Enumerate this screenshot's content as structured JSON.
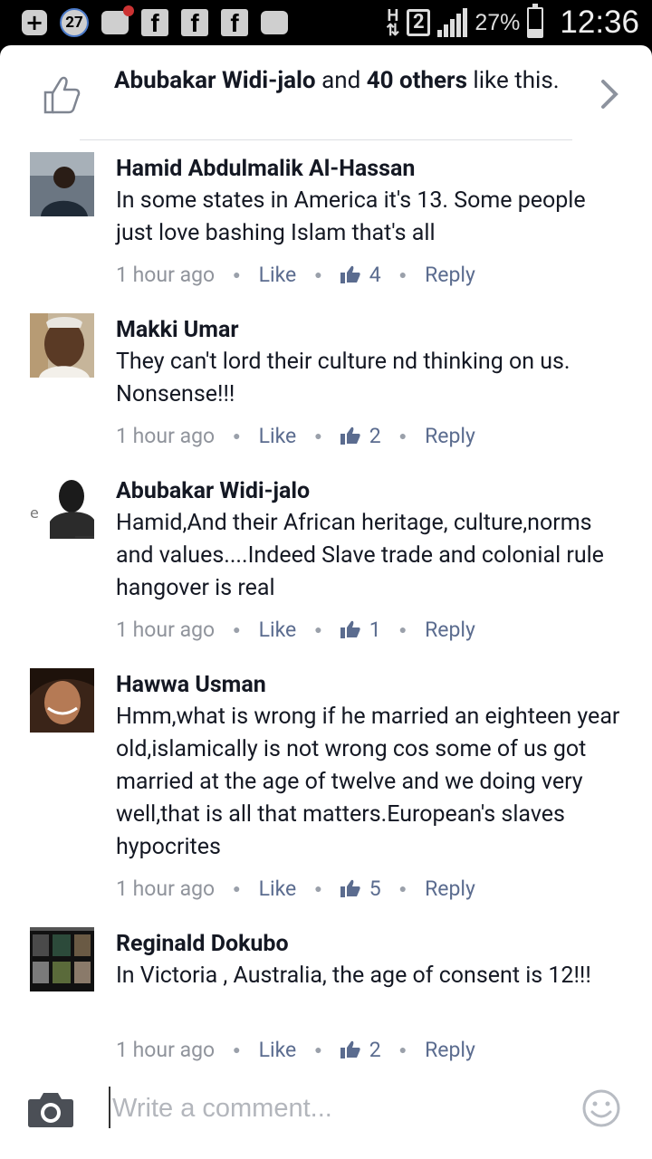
{
  "status_bar": {
    "notification_count": "27",
    "network_type": "H",
    "sim_slot": "2",
    "battery_percent": "27%",
    "time": "12:36"
  },
  "likes": {
    "first_name": "Abubakar Widi-jalo",
    "connector": " and ",
    "others": "40 others",
    "suffix": " like this."
  },
  "comments": [
    {
      "author": "Hamid Abdulmalik Al-Hassan",
      "text": "In some states in America it's 13. Some people just love bashing Islam that's all",
      "time": "1 hour ago",
      "like_label": "Like",
      "like_count": "4",
      "reply_label": "Reply"
    },
    {
      "author": "Makki Umar",
      "text": "They can't lord their culture nd thinking on us. Nonsense!!!",
      "time": "1 hour ago",
      "like_label": "Like",
      "like_count": "2",
      "reply_label": "Reply"
    },
    {
      "author": "Abubakar Widi-jalo",
      "text": "Hamid,And their African heritage, culture,norms and values....Indeed Slave trade and colonial rule hangover is real",
      "time": "1 hour ago",
      "like_label": "Like",
      "like_count": "1",
      "reply_label": "Reply"
    },
    {
      "author": "Hawwa Usman",
      "text": "Hmm,what is wrong if he married an eighteen year old,islamically is not wrong cos some of us got married at the age of twelve and we doing very well,that is all that matters.European's slaves hypocrites",
      "time": "1 hour ago",
      "like_label": "Like",
      "like_count": "5",
      "reply_label": "Reply"
    },
    {
      "author": "Reginald Dokubo",
      "text": "In Victoria , Australia, the age of consent is 12!!!",
      "time": "1 hour ago",
      "like_label": "Like",
      "like_count": "2",
      "reply_label": "Reply"
    }
  ],
  "composer": {
    "placeholder": "Write a comment..."
  },
  "colors": {
    "link": "#5b6c8f",
    "meta": "#90949c",
    "text": "#141823",
    "divider": "#dcdee3"
  }
}
